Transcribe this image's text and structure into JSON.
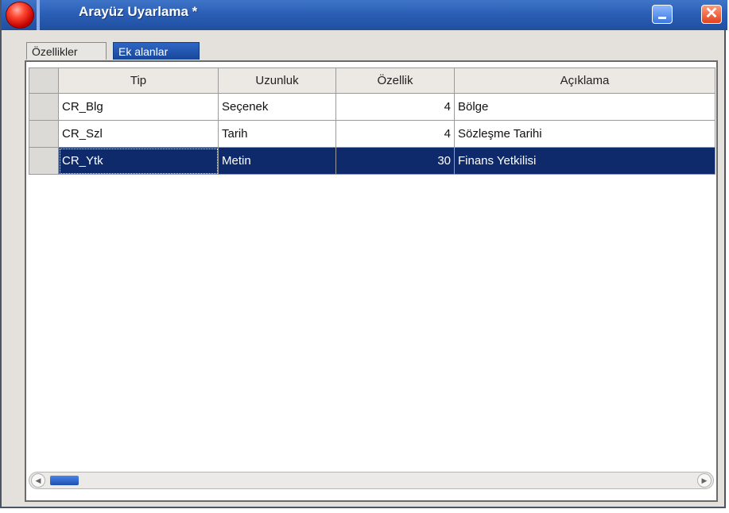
{
  "window": {
    "title": "Arayüz Uyarlama *",
    "close_glyph": "✕"
  },
  "tabs": [
    {
      "label": "Özellikler",
      "active": false
    },
    {
      "label": "Ek alanlar",
      "active": true
    }
  ],
  "grid": {
    "columns": [
      "Tip",
      "Uzunluk",
      "Özellik",
      "Açıklama"
    ],
    "rows": [
      {
        "tip": "CR_Blg",
        "uzunluk": "Seçenek",
        "ozellik": "4",
        "aciklama": "Bölge",
        "selected": false
      },
      {
        "tip": "CR_Szl",
        "uzunluk": "Tarih",
        "ozellik": "4",
        "aciklama": "Sözleşme Tarihi",
        "selected": false
      },
      {
        "tip": "CR_Ytk",
        "uzunluk": "Metin",
        "ozellik": "30",
        "aciklama": "Finans Yetkilisi",
        "selected": true
      }
    ]
  },
  "scrollbar": {
    "left_arrow": "◀",
    "right_arrow": "▶"
  },
  "colors": {
    "titlebar": "#2b5fb6",
    "selected_row": "#0f2a6a",
    "close_button": "#e0421e"
  }
}
